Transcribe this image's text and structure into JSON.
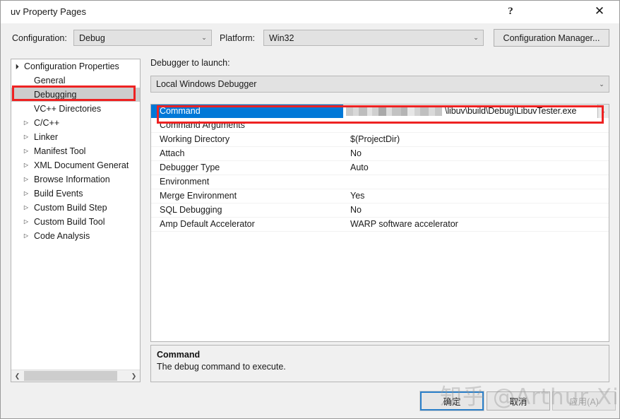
{
  "window": {
    "title": "uv Property Pages",
    "help_glyph": "?",
    "close_glyph": "✕"
  },
  "toolbar": {
    "configuration_label": "Configuration:",
    "configuration_value": "Debug",
    "platform_label": "Platform:",
    "platform_value": "Win32",
    "configuration_manager_label": "Configuration Manager...",
    "chevron": "⌄"
  },
  "tree": {
    "items": [
      {
        "label": "Configuration Properties",
        "depth": 0,
        "twisty": "▲",
        "selected": false
      },
      {
        "label": "General",
        "depth": 1,
        "twisty": "",
        "selected": false
      },
      {
        "label": "Debugging",
        "depth": 1,
        "twisty": "",
        "selected": true
      },
      {
        "label": "VC++ Directories",
        "depth": 1,
        "twisty": "",
        "selected": false
      },
      {
        "label": "C/C++",
        "depth": 1,
        "twisty": "▷",
        "selected": false
      },
      {
        "label": "Linker",
        "depth": 1,
        "twisty": "▷",
        "selected": false
      },
      {
        "label": "Manifest Tool",
        "depth": 1,
        "twisty": "▷",
        "selected": false
      },
      {
        "label": "XML Document Generat",
        "depth": 1,
        "twisty": "▷",
        "selected": false
      },
      {
        "label": "Browse Information",
        "depth": 1,
        "twisty": "▷",
        "selected": false
      },
      {
        "label": "Build Events",
        "depth": 1,
        "twisty": "▷",
        "selected": false
      },
      {
        "label": "Custom Build Step",
        "depth": 1,
        "twisty": "▷",
        "selected": false
      },
      {
        "label": "Custom Build Tool",
        "depth": 1,
        "twisty": "▷",
        "selected": false
      },
      {
        "label": "Code Analysis",
        "depth": 1,
        "twisty": "▷",
        "selected": false
      }
    ],
    "scrollbar": {
      "left_arrow": "❮",
      "right_arrow": "❯"
    }
  },
  "main": {
    "debugger_label": "Debugger to launch:",
    "debugger_value": "Local Windows Debugger",
    "grid": {
      "rows": [
        {
          "name": "Command",
          "value": "",
          "selected": true,
          "editor": true
        },
        {
          "name": "Command Arguments",
          "value": "",
          "selected": false
        },
        {
          "name": "Working Directory",
          "value": "$(ProjectDir)",
          "selected": false
        },
        {
          "name": "Attach",
          "value": "No",
          "selected": false
        },
        {
          "name": "Debugger Type",
          "value": "Auto",
          "selected": false
        },
        {
          "name": "Environment",
          "value": "",
          "selected": false
        },
        {
          "name": "Merge Environment",
          "value": "Yes",
          "selected": false
        },
        {
          "name": "SQL Debugging",
          "value": "No",
          "selected": false
        },
        {
          "name": "Amp Default Accelerator",
          "value": "WARP software accelerator",
          "selected": false
        }
      ],
      "command_editor": {
        "visible_path": "\\libuv\\build\\Debug\\LibuvTester.exe",
        "redacted_prefix": true,
        "dropdown_glyph": "⌄"
      }
    },
    "description": {
      "title": "Command",
      "body": "The debug command to execute."
    }
  },
  "buttons": {
    "ok": "确定",
    "cancel": "取消",
    "apply": "应用(A)"
  },
  "watermark": {
    "text": "知乎 @Arthur Xin"
  },
  "colors": {
    "selection_blue": "#0078d7",
    "annotation_red": "#ee2222",
    "tree_selection_gray": "#cdcdcd",
    "focus_border_blue": "#2a7fc9",
    "dialog_bg": "#f0f0f0"
  }
}
